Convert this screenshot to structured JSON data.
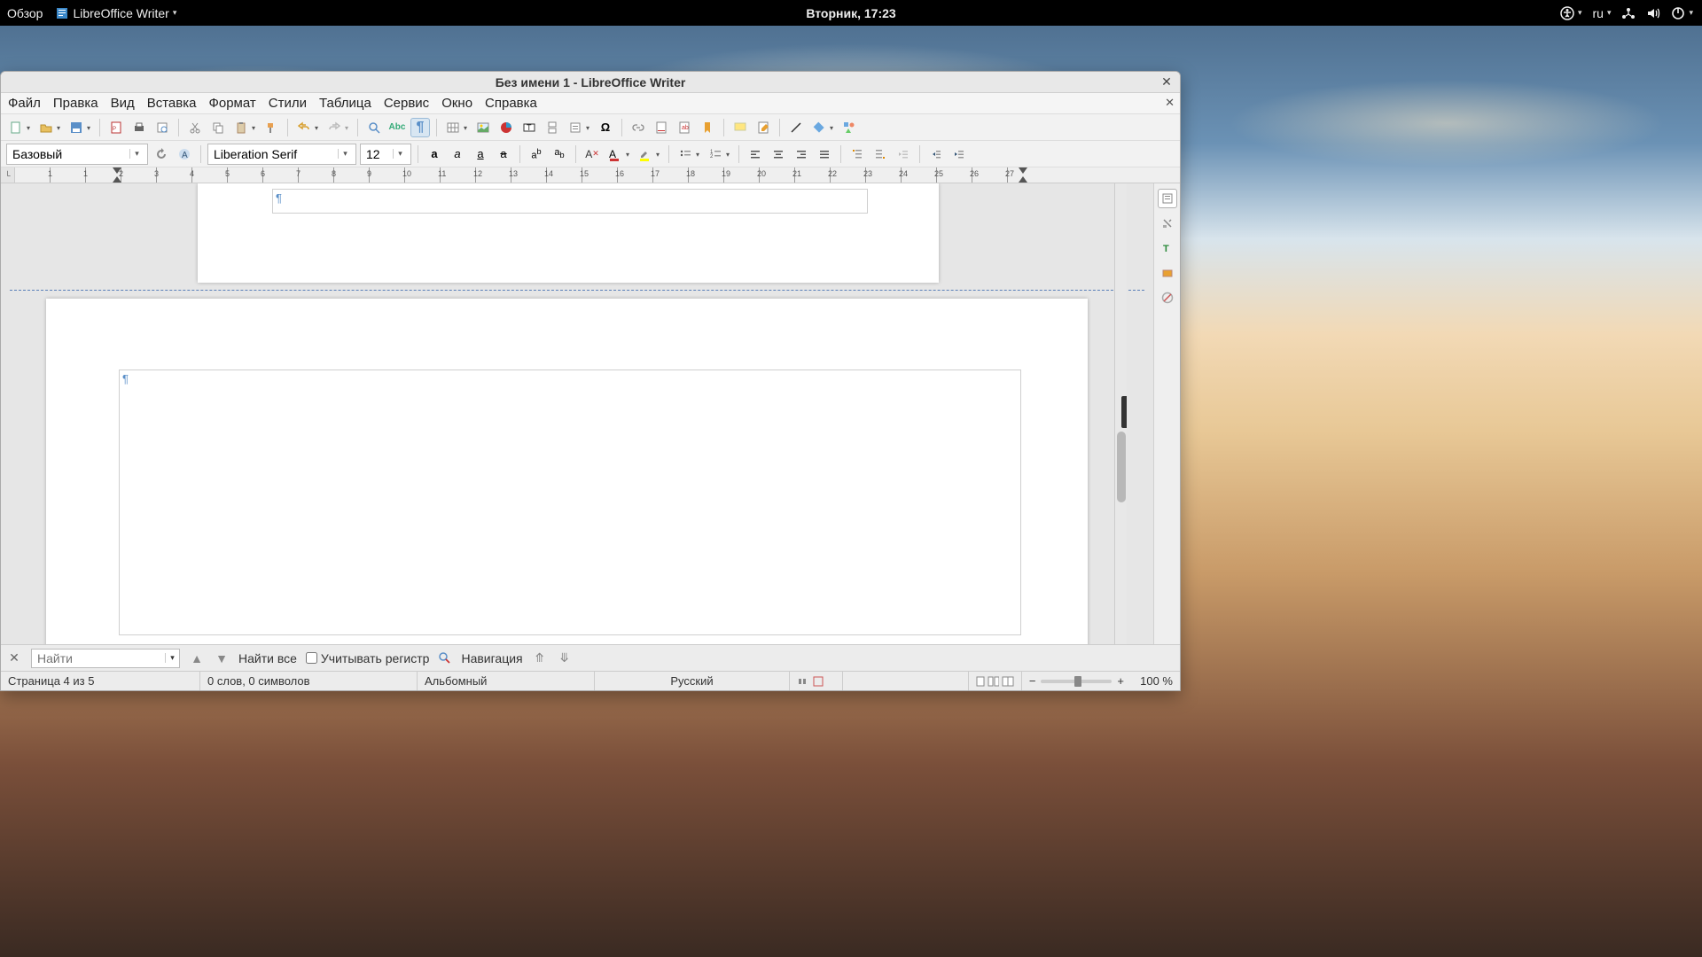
{
  "os": {
    "activities": "Обзор",
    "app_label": "LibreOffice Writer",
    "clock": "Вторник, 17:23",
    "input_lang": "ru"
  },
  "window": {
    "title": "Без имени 1 - LibreOffice Writer"
  },
  "menu": {
    "file": "Файл",
    "edit": "Правка",
    "view": "Вид",
    "insert": "Вставка",
    "format": "Формат",
    "styles": "Стили",
    "table": "Таблица",
    "tools": "Сервис",
    "window": "Окно",
    "help": "Справка"
  },
  "format_bar": {
    "para_style": "Базовый",
    "font_name": "Liberation Serif",
    "font_size": "12"
  },
  "ruler": {
    "ticks": [
      "1",
      "1",
      "2",
      "3",
      "4",
      "5",
      "6",
      "7",
      "8",
      "9",
      "10",
      "11",
      "12",
      "13",
      "14",
      "15",
      "16",
      "17",
      "18",
      "19",
      "20",
      "21",
      "22",
      "23",
      "24",
      "25",
      "26",
      "27"
    ]
  },
  "findbar": {
    "placeholder": "Найти",
    "find_all": "Найти все",
    "match_case": "Учитывать регистр",
    "navigation": "Навигация"
  },
  "status": {
    "page": "Страница 4 из 5",
    "words": "0 слов, 0 символов",
    "page_style": "Альбомный",
    "language": "Русский",
    "zoom": "100 %"
  }
}
